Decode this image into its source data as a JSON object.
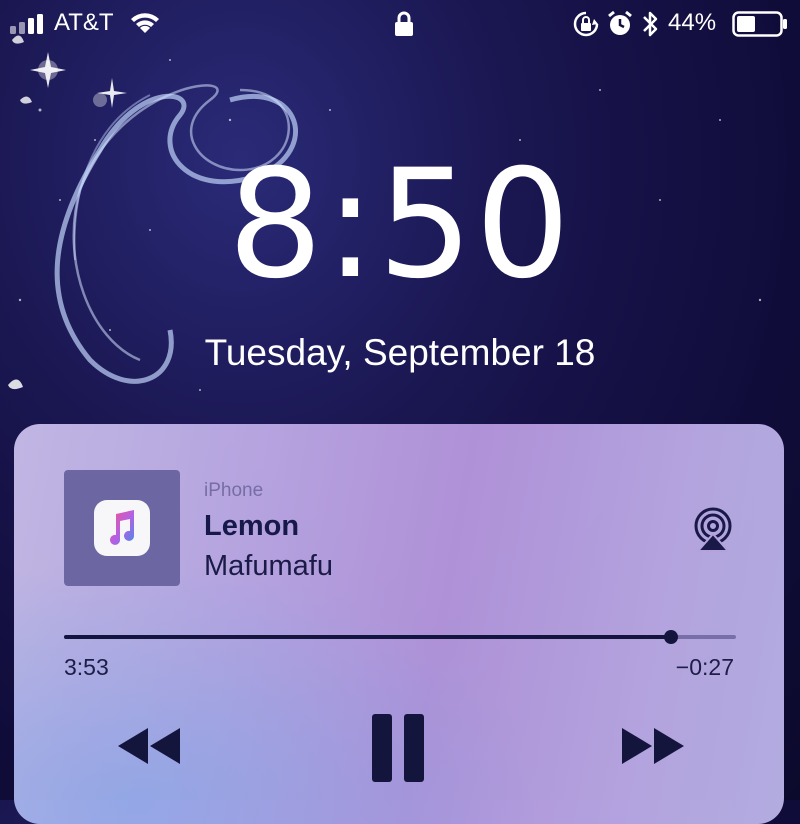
{
  "status_bar": {
    "carrier": "AT&T",
    "battery_percent": "44%",
    "battery_level": 0.44,
    "icons": [
      "signal-icon",
      "wifi-icon",
      "lock-icon",
      "rotation-lock-icon",
      "alarm-icon",
      "bluetooth-icon",
      "battery-icon"
    ]
  },
  "lock_screen": {
    "time": "8:50",
    "date": "Tuesday, September 18"
  },
  "now_playing": {
    "source": "iPhone",
    "title": "Lemon",
    "artist": "Mafumafu",
    "elapsed": "3:53",
    "remaining": "−0:27",
    "progress": 0.904,
    "icons": [
      "music-app-icon",
      "airplay-icon",
      "rewind-icon",
      "pause-icon",
      "fast-forward-icon"
    ]
  },
  "colors": {
    "accent_dark": "#15163e",
    "card_start": "#c6bce8",
    "card_mid": "#b496dc"
  }
}
